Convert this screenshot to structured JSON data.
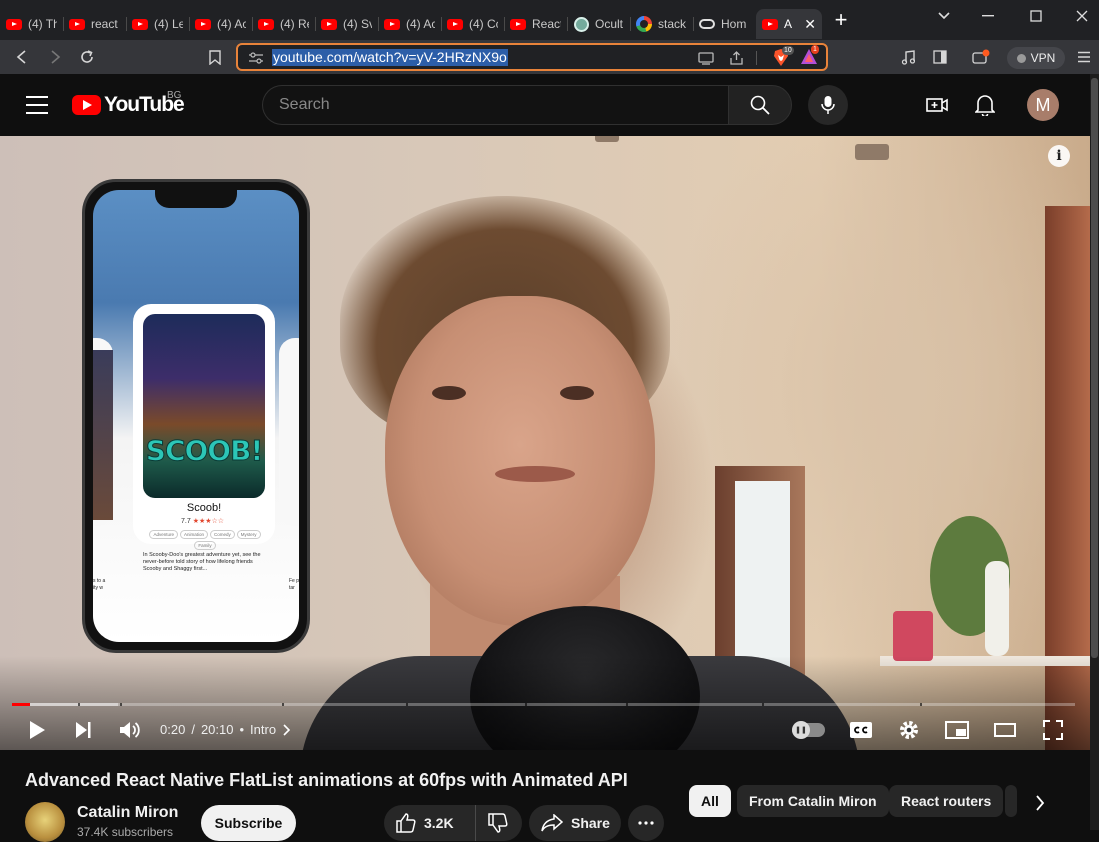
{
  "browser": {
    "tabs": [
      {
        "icon": "youtube-favicon",
        "label": "(4) Th"
      },
      {
        "icon": "youtube-favicon",
        "label": "react"
      },
      {
        "icon": "youtube-favicon",
        "label": "(4) Le"
      },
      {
        "icon": "youtube-favicon",
        "label": "(4) Ac"
      },
      {
        "icon": "youtube-favicon",
        "label": "(4) Re"
      },
      {
        "icon": "youtube-favicon",
        "label": "(4) Sv"
      },
      {
        "icon": "youtube-favicon",
        "label": "(4) Ac"
      },
      {
        "icon": "youtube-favicon",
        "label": "(4) Cc"
      },
      {
        "icon": "youtube-favicon",
        "label": "React"
      },
      {
        "icon": "chatgpt-favicon",
        "label": "Ocult"
      },
      {
        "icon": "google-favicon",
        "label": "stack"
      },
      {
        "icon": "home-favicon",
        "label": "Hom"
      },
      {
        "icon": "youtube-favicon",
        "label": "A",
        "active": true
      }
    ],
    "url": "youtube.com/watch?v=yV-2HRzNX9o",
    "shields_count": "10",
    "rewards_count": "1",
    "vpn_label": "VPN"
  },
  "youtube": {
    "logo_text": "YouTube",
    "country_code": "BG",
    "search_placeholder": "Search",
    "avatar_letter": "M"
  },
  "player": {
    "progress_fraction": 0.0165,
    "buffer_fraction": 0.1,
    "time_current": "0:20",
    "time_separator": "/",
    "time_total": "20:10",
    "chapter_separator": "•",
    "chapter": "Intro",
    "overlay": {
      "movie_title": "Scoob!",
      "poster_title": "SCOOB!",
      "rating_value": "7.7",
      "rating_stars": "★★★☆☆",
      "genres": [
        "Adventure",
        "Animation",
        "Comedy",
        "Mystery",
        "Family"
      ],
      "description": "In Scooby-Doo's greatest adventure yet, see the never-before told story of how lifelong friends Scooby and Shaggy first...",
      "left_snippet": "s to a ity w",
      "right_snippet": "Fe pic tar"
    }
  },
  "video": {
    "title": "Advanced React Native FlatList animations at 60fps with Animated API",
    "channel_name": "Catalin Miron",
    "subscribers": "37.4K subscribers",
    "subscribe_label": "Subscribe",
    "likes": "3.2K",
    "share_label": "Share"
  },
  "chips": [
    "All",
    "From Catalin Miron",
    "React routers"
  ],
  "colors": {
    "youtube_red": "#ff0000",
    "omnibox_focus": "#e8833a",
    "url_selection": "#2c5ea8"
  }
}
